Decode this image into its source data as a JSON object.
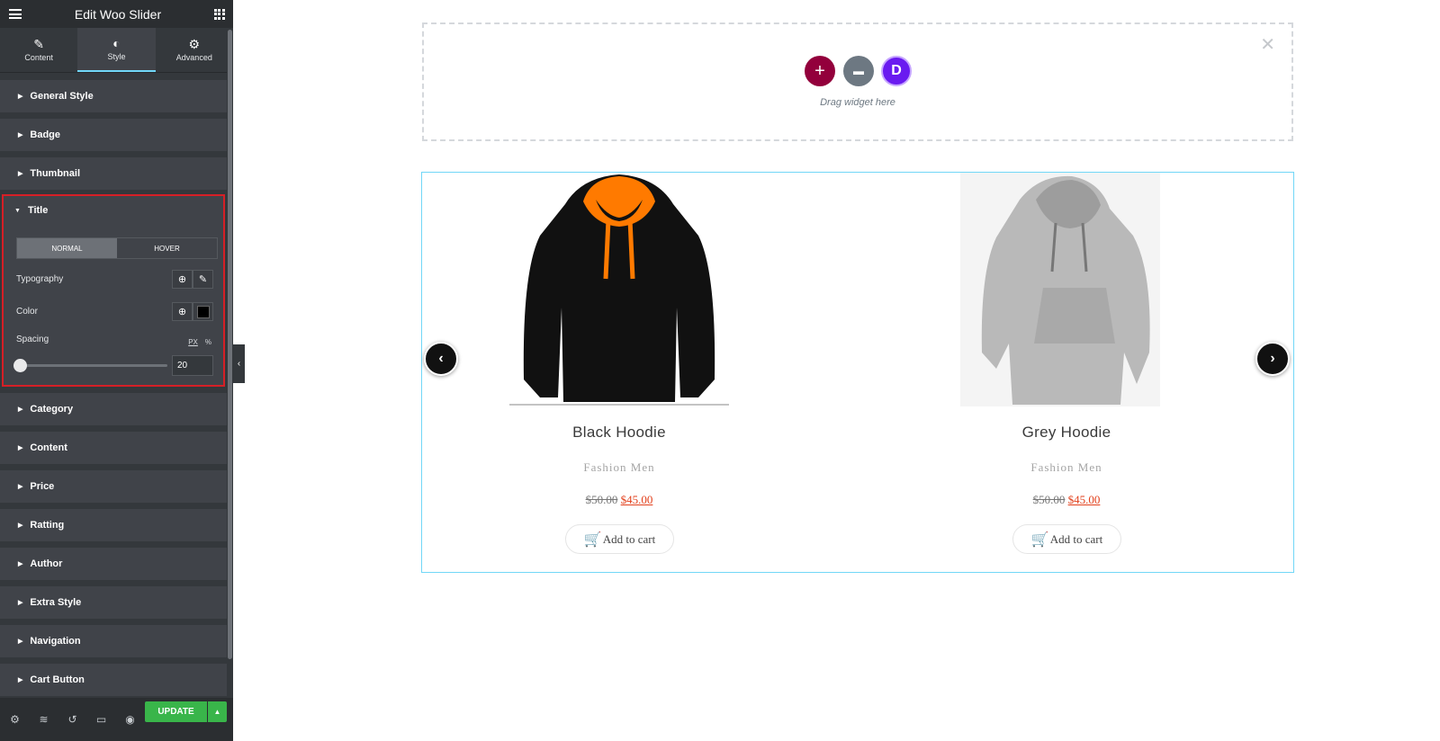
{
  "panel": {
    "title": "Edit Woo Slider",
    "tabs": [
      {
        "label": "Content",
        "icon": "pencil-icon"
      },
      {
        "label": "Style",
        "icon": "contrast-icon"
      },
      {
        "label": "Advanced",
        "icon": "gear-icon"
      }
    ],
    "sections_before": [
      "General Style",
      "Badge",
      "Thumbnail"
    ],
    "title_section": {
      "label": "Title",
      "state_tabs": [
        "NORMAL",
        "HOVER"
      ],
      "typography_label": "Typography",
      "color_label": "Color",
      "color_value": "#000000",
      "spacing_label": "Spacing",
      "unit_px": "PX",
      "unit_percent": "%",
      "spacing_value": "20"
    },
    "sections_after": [
      "Category",
      "Content",
      "Price",
      "Ratting",
      "Author",
      "Extra Style",
      "Navigation",
      "Cart Button"
    ],
    "update_label": "UPDATE",
    "accent_color": "#71d7f7",
    "highlight_color": "#d61f26",
    "update_color": "#39b54a"
  },
  "canvas": {
    "drop_text": "Drag widget here",
    "products": [
      {
        "name": "Black Hoodie",
        "category": "Fashion Men",
        "old_price": "$50.00",
        "new_price": "$45.00",
        "cart_label": "Add to cart"
      },
      {
        "name": "Grey Hoodie",
        "category": "Fashion Men",
        "old_price": "$50.00",
        "new_price": "$45.00",
        "cart_label": "Add to cart"
      }
    ]
  }
}
